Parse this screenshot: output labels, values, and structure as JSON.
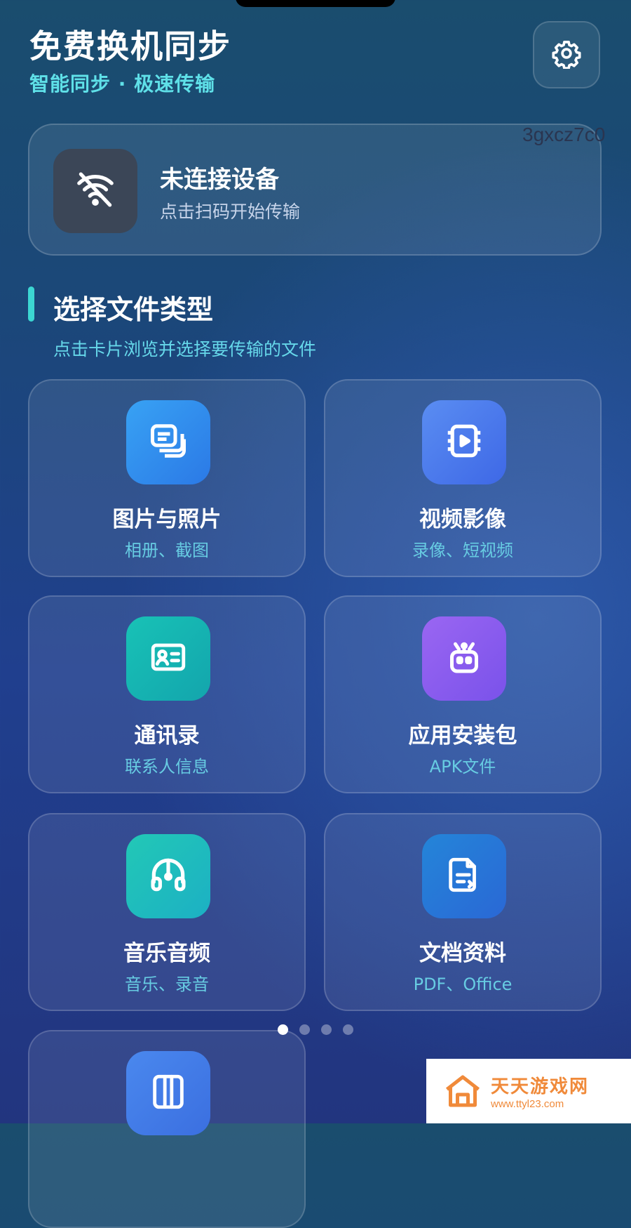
{
  "header": {
    "title": "免费换机同步",
    "subtitle": "智能同步 · 极速传输",
    "settings_icon": "gear-icon"
  },
  "watermark_code": "3gxcz7c0",
  "device": {
    "status": "未连接设备",
    "hint": "点击扫码开始传输",
    "icon": "wifi-off-icon"
  },
  "section": {
    "title": "选择文件类型",
    "subtitle": "点击卡片浏览并选择要传输的文件"
  },
  "categories": [
    {
      "title": "图片与照片",
      "subtitle": "相册、截图",
      "icon": "photos-icon",
      "color": "#2f8ff0"
    },
    {
      "title": "视频影像",
      "subtitle": "录像、短视频",
      "icon": "video-icon",
      "color": "#4a7bee"
    },
    {
      "title": "通讯录",
      "subtitle": "联系人信息",
      "icon": "contact-card-icon",
      "color": "#16b8b0"
    },
    {
      "title": "应用安装包",
      "subtitle": "APK文件",
      "icon": "android-robot-icon",
      "color": "#8a5cf0"
    },
    {
      "title": "音乐音频",
      "subtitle": "音乐、录音",
      "icon": "headphones-icon",
      "color": "#1ec2be"
    },
    {
      "title": "文档资料",
      "subtitle": "PDF、Office",
      "icon": "document-icon",
      "color": "#2a74d8"
    },
    {
      "title": "",
      "subtitle": "",
      "icon": "file-box-icon",
      "color": "#3f78e0"
    }
  ],
  "pager": {
    "count": 4,
    "active_index": 0
  },
  "site_watermark": {
    "name": "天天游戏网",
    "url": "www.ttyl23.com"
  }
}
